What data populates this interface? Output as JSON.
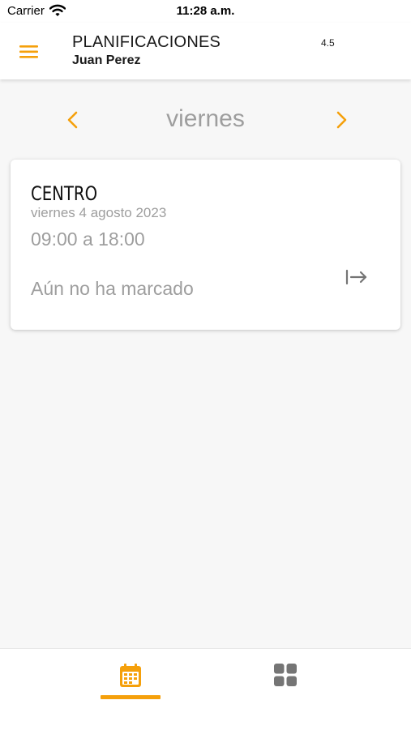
{
  "status_bar": {
    "carrier": "Carrier",
    "time": "11:28 a.m."
  },
  "app_bar": {
    "title": "PLANIFICACIONES",
    "user": "Juan Perez",
    "version": "4.5"
  },
  "day_nav": {
    "day": "viernes"
  },
  "shift": {
    "location": "CENTRO",
    "date": "viernes 4 agosto 2023",
    "hours": "09:00 a 18:00",
    "status": "Aún no ha marcado"
  },
  "colors": {
    "accent": "#f5a00b",
    "muted_text": "#9e9e9e",
    "inactive_icon": "#757575",
    "background": "#f7f7f7"
  },
  "icons": {
    "menu": "hamburger-menu-icon",
    "prev": "chevron-left-icon",
    "next": "chevron-right-icon",
    "clock_in": "arrow-right-to-bar-icon",
    "calendar": "calendar-icon",
    "grid": "grid-icon"
  },
  "bottom_nav": {
    "active_tab": "calendar"
  }
}
